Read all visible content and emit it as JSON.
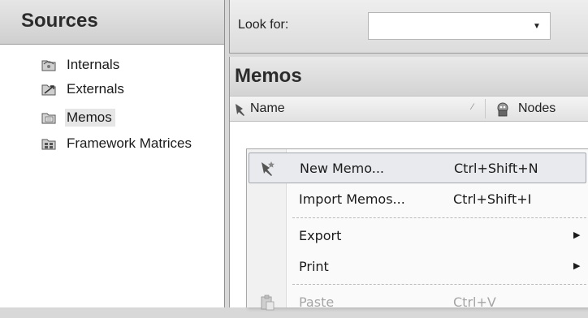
{
  "sources": {
    "title": "Sources",
    "items": [
      {
        "label": "Internals",
        "icon": "internals-folder-icon"
      },
      {
        "label": "Externals",
        "icon": "externals-folder-icon"
      },
      {
        "label": "Memos",
        "icon": "memos-folder-icon",
        "selected": true
      },
      {
        "label": "Framework Matrices",
        "icon": "framework-matrices-icon"
      }
    ]
  },
  "lookfor": {
    "label": "Look for:",
    "value": "",
    "dropdown_icon": "dropdown-arrow-icon"
  },
  "memos": {
    "title": "Memos",
    "columns": [
      {
        "label": "Name",
        "icon": "name-pin-icon"
      },
      {
        "label": "Nodes",
        "icon": "nodes-icon"
      }
    ]
  },
  "context_menu": {
    "items": [
      {
        "label": "New Memo...",
        "shortcut": "Ctrl+Shift+N",
        "icon": "new-memo-icon"
      },
      {
        "label": "Import Memos...",
        "shortcut": "Ctrl+Shift+I"
      },
      {
        "label": "Export",
        "submenu": true
      },
      {
        "label": "Print",
        "submenu": true
      },
      {
        "label": "Paste",
        "shortcut": "Ctrl+V",
        "icon": "paste-icon",
        "disabled": true
      }
    ]
  },
  "colors": {
    "header_bg": "#d3d3d3",
    "menu_hover": "#e8eaed",
    "selected_item": "#e6e6e6"
  }
}
